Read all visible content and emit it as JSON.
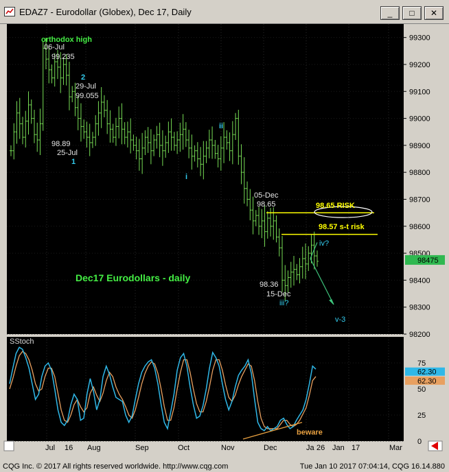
{
  "window": {
    "title": "EDAZ7 - Eurodollar (Globex), Dec 17, Daily",
    "minimize_label": "_",
    "restore_label": "□",
    "close_label": "✕"
  },
  "colors": {
    "background": "#000000",
    "price_bars": "#77dd55",
    "stoch_k": "#2fb8e8",
    "stoch_d": "#e8a060",
    "annotation_green": "#44ee44",
    "annotation_white": "#e6e6e6",
    "annotation_cyan": "#33ccee",
    "risk_line": "#ffff00",
    "projection_arrow": "#3ec47c",
    "trendline": "#e8a040"
  },
  "chart_data": [
    {
      "type": "line",
      "title": "",
      "subtitle": "",
      "ylim": [
        98.2,
        99.35
      ],
      "yticks": [
        "99300",
        "99200",
        "99100",
        "99000",
        "98900",
        "98800",
        "98700",
        "98600",
        "98500",
        "98400",
        "98300",
        "98200"
      ],
      "x_month_labels": [
        "Jul",
        "16",
        "Aug",
        "Sep",
        "Oct",
        "Nov",
        "Dec",
        "Ja",
        "26",
        "Jan",
        "17",
        "Mar"
      ],
      "last_price_label": "98475",
      "series": [
        {
          "values": [
            98.88,
            98.95,
            99.02,
            98.98,
            98.93,
            98.99,
            99.05,
            99.0,
            98.94,
            98.92,
            98.98,
            99.26,
            99.22,
            99.18,
            99.15,
            99.21,
            99.19,
            99.15,
            99.2,
            99.16,
            99.08,
            99.1,
            99.04,
            99.0,
            98.97,
            98.95,
            98.93,
            98.91,
            98.93,
            98.98,
            99.02,
            99.06,
            99.03,
            98.98,
            98.96,
            98.93,
            98.97,
            99.0,
            98.96,
            98.93,
            98.95,
            98.92,
            98.9,
            98.88,
            98.85,
            98.89,
            98.93,
            98.91,
            98.88,
            98.92,
            98.94,
            98.9,
            98.88,
            98.91,
            98.95,
            98.93,
            98.9,
            98.92,
            98.94,
            98.96,
            98.92,
            98.89,
            98.86,
            98.88,
            98.85,
            98.83,
            98.86,
            98.89,
            98.92,
            98.9,
            98.87,
            98.85,
            98.89,
            98.93,
            98.91,
            98.88,
            98.94,
            99.0,
            98.86,
            98.8,
            98.74,
            98.7,
            98.66,
            98.62,
            98.64,
            98.6,
            98.62,
            98.58,
            98.63,
            98.6,
            98.62,
            98.56,
            98.52,
            98.4,
            98.38,
            98.41,
            98.43,
            98.44,
            98.42,
            98.45,
            98.48,
            98.46,
            98.5,
            98.53,
            98.49,
            98.47
          ]
        }
      ],
      "annotations": [
        {
          "text": "orthodox high",
          "color": "green"
        },
        {
          "text": "06-Jul",
          "color": "white"
        },
        {
          "text": "99.235",
          "color": "white"
        },
        {
          "text": "2",
          "color": "cyan"
        },
        {
          "text": "29-Jul",
          "color": "white"
        },
        {
          "text": "99.055",
          "color": "white"
        },
        {
          "text": "98.89",
          "color": "white"
        },
        {
          "text": "25-Jul",
          "color": "white"
        },
        {
          "text": "1",
          "color": "cyan"
        },
        {
          "text": "ii",
          "color": "cyan"
        },
        {
          "text": "i",
          "color": "cyan"
        },
        {
          "text": "05-Dec",
          "color": "white"
        },
        {
          "text": "98.65",
          "color": "white"
        },
        {
          "text": "98.65 RISK",
          "color": "yellow"
        },
        {
          "text": "98.57 s-t risk",
          "color": "yellow"
        },
        {
          "text": "iv?",
          "color": "cyan"
        },
        {
          "text": "Dec17 Eurodollars - daily",
          "color": "green"
        },
        {
          "text": "98.36",
          "color": "white"
        },
        {
          "text": "15-Dec",
          "color": "white"
        },
        {
          "text": "iii?",
          "color": "cyan"
        },
        {
          "text": "v-3",
          "color": "cyan"
        }
      ],
      "risk_levels": [
        {
          "label": "98.65 RISK",
          "value": 98.65
        },
        {
          "label": "98.57 s-t risk",
          "value": 98.57
        }
      ]
    },
    {
      "type": "line",
      "title": "SStoch",
      "ylim": [
        0,
        100
      ],
      "yticks": [
        "75",
        "50",
        "25",
        "0"
      ],
      "value_badges": [
        {
          "text": "62.30",
          "color": "cyan"
        },
        {
          "text": "62.30",
          "color": "orange"
        }
      ],
      "series": [
        {
          "name": "",
          "values": [
            55,
            70,
            84,
            90,
            88,
            80,
            70,
            55,
            40,
            45,
            62,
            72,
            75,
            68,
            50,
            30,
            18,
            15,
            20,
            35,
            45,
            40,
            20,
            22,
            45,
            60,
            48,
            30,
            40,
            62,
            72,
            64,
            52,
            42,
            40,
            38,
            25,
            18,
            24,
            40,
            55,
            66,
            72,
            76,
            78,
            70,
            55,
            35,
            18,
            12,
            28,
            45,
            68,
            80,
            84,
            72,
            52,
            35,
            22,
            24,
            34,
            50,
            70,
            85,
            80,
            72,
            55,
            40,
            30,
            38,
            52,
            63,
            68,
            72,
            78,
            65,
            40,
            18,
            12,
            10,
            14,
            10,
            12,
            14,
            20,
            22,
            16,
            12,
            14,
            20,
            25,
            30,
            40,
            55,
            72,
            69
          ]
        },
        {
          "name": "",
          "values": [
            50,
            60,
            72,
            82,
            86,
            84,
            78,
            68,
            55,
            48,
            50,
            62,
            70,
            70,
            62,
            46,
            30,
            20,
            18,
            25,
            35,
            40,
            33,
            28,
            32,
            46,
            52,
            44,
            38,
            46,
            58,
            66,
            62,
            52,
            45,
            40,
            33,
            25,
            22,
            30,
            42,
            55,
            65,
            72,
            76,
            74,
            65,
            50,
            33,
            20,
            20,
            32,
            50,
            66,
            78,
            78,
            66,
            50,
            36,
            28,
            28,
            38,
            52,
            68,
            78,
            78,
            68,
            54,
            42,
            38,
            44,
            54,
            62,
            68,
            74,
            72,
            58,
            38,
            22,
            14,
            12,
            12,
            12,
            12,
            16,
            20,
            20,
            16,
            14,
            16,
            20,
            26,
            32,
            44,
            58,
            62
          ]
        }
      ],
      "annotations": [
        {
          "text": "beware",
          "color": "orange"
        }
      ]
    }
  ],
  "footer": {
    "copyright": "CQG Inc. © 2017 All rights reserved worldwide.  http://www.cqg.com",
    "timestamp": "Tue Jan 10 2017 07:04:14, CQG 16.14.880"
  }
}
